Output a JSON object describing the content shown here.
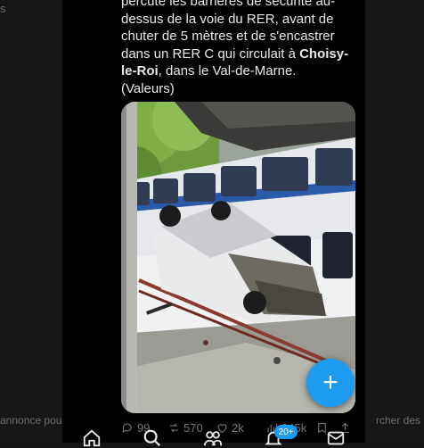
{
  "left_panel": {
    "dim_text": "s",
    "footer_text": "annonce pou"
  },
  "right_panel": {
    "footer_text": "rcher des"
  },
  "tweet": {
    "line1": "percute les barrières de sécurité au-",
    "line2": "dessus de la voie du RER, avant de",
    "line3": "chuter de 5 mètres et de s'encastrer",
    "line4_pre": "dans un RER C qui circulait à ",
    "line4_bold": "Choisy-",
    "line5_bold": "le-Roi",
    "line5_post": ", dans le Val-de-Marne.",
    "line6": "(Valeurs)"
  },
  "media": {
    "alt": "photo: voiture renversée sur les voies à côté d'un RER C"
  },
  "actions": {
    "replies": "99",
    "reposts": "570",
    "likes": "2k",
    "views": "345k"
  },
  "nav": {
    "badge_count": "20+"
  },
  "icons": {
    "reply": "reply-icon",
    "repost": "repost-icon",
    "like": "heart-icon",
    "views": "views-icon",
    "bookmark": "bookmark-icon",
    "share": "share-icon",
    "compose": "plus-icon",
    "home": "home-icon",
    "search": "search-icon",
    "communities": "people-icon",
    "notifications": "bell-icon",
    "messages": "mail-icon"
  },
  "colors": {
    "accent": "#1d9bf0",
    "background": "#000000",
    "muted": "#71767b"
  }
}
